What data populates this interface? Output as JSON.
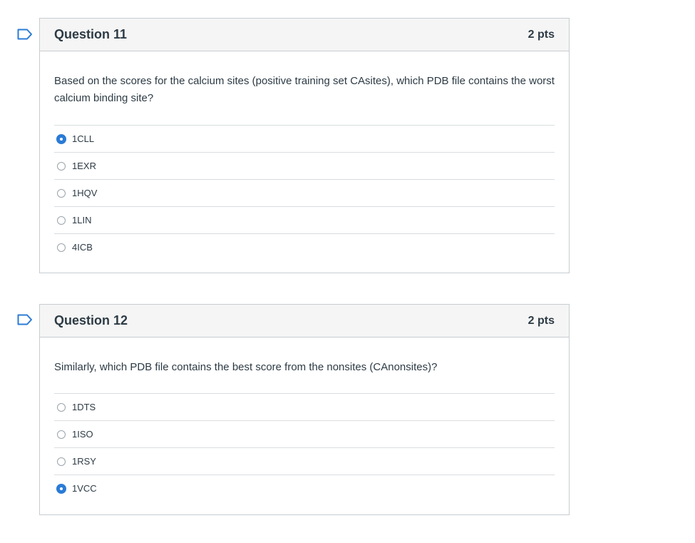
{
  "questions": [
    {
      "title": "Question 11",
      "points": "2 pts",
      "text": "Based on the scores for the calcium sites (positive training set CAsites), which PDB file contains the worst calcium binding site?",
      "answers": [
        {
          "label": "1CLL",
          "selected": true
        },
        {
          "label": "1EXR",
          "selected": false
        },
        {
          "label": "1HQV",
          "selected": false
        },
        {
          "label": "1LIN",
          "selected": false
        },
        {
          "label": "4ICB",
          "selected": false
        }
      ]
    },
    {
      "title": "Question 12",
      "points": "2 pts",
      "text": "Similarly, which PDB file contains the best score from the nonsites (CAnonsites)?",
      "answers": [
        {
          "label": "1DTS",
          "selected": false
        },
        {
          "label": "1ISO",
          "selected": false
        },
        {
          "label": "1RSY",
          "selected": false
        },
        {
          "label": "1VCC",
          "selected": true
        }
      ]
    }
  ],
  "colors": {
    "accent": "#2b7bd6",
    "header_bg": "#f5f5f5",
    "border": "#c7cdd1"
  },
  "icons": {
    "flag": "bookmark-flag-icon",
    "radio": "radio-button"
  }
}
